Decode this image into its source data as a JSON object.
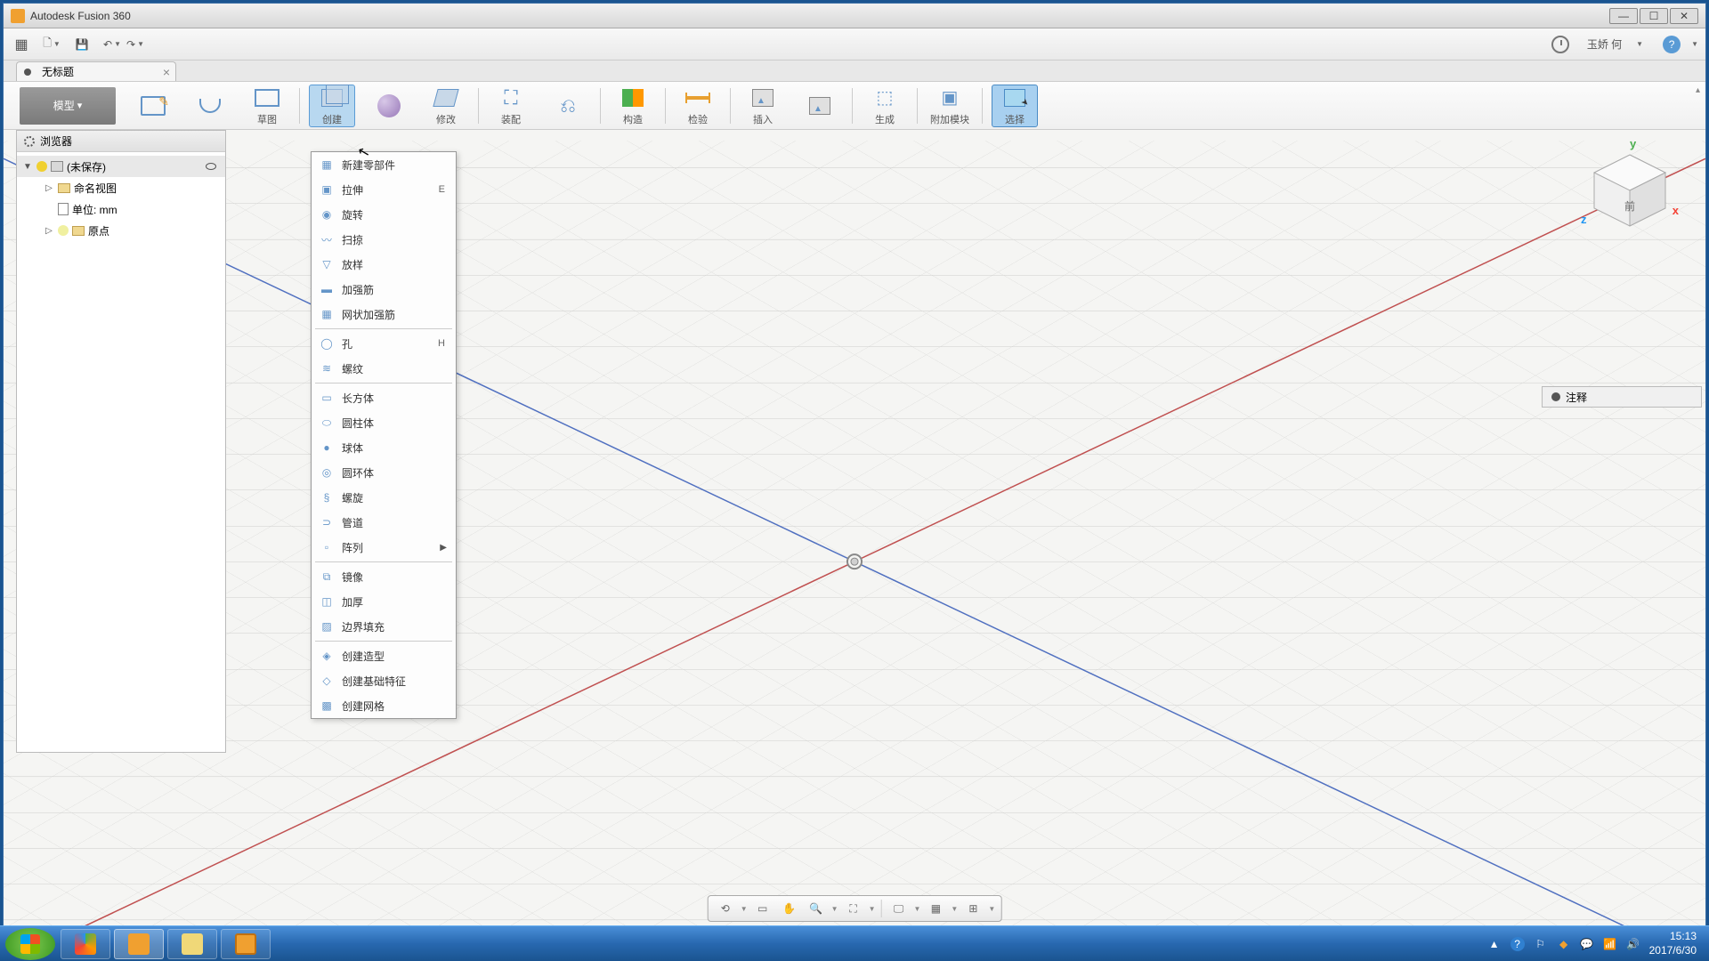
{
  "window": {
    "title": "Autodesk Fusion 360",
    "user": "玉娇 何"
  },
  "tab": {
    "title": "无标题"
  },
  "workspace": {
    "label": "模型"
  },
  "ribbon": {
    "sketch": "草图",
    "create": "创建",
    "modify": "修改",
    "assemble": "装配",
    "construct": "构造",
    "inspect": "检验",
    "insert": "插入",
    "make": "生成",
    "addins": "附加模块",
    "select": "选择"
  },
  "browser": {
    "header": "浏览器",
    "root": "(未保存)",
    "named_views": "命名视图",
    "units": "单位: mm",
    "origin": "原点"
  },
  "create_menu": {
    "items": [
      {
        "label": "新建零部件",
        "shortcut": "",
        "group": 0
      },
      {
        "label": "拉伸",
        "shortcut": "E",
        "group": 0
      },
      {
        "label": "旋转",
        "shortcut": "",
        "group": 0
      },
      {
        "label": "扫掠",
        "shortcut": "",
        "group": 0
      },
      {
        "label": "放样",
        "shortcut": "",
        "group": 0
      },
      {
        "label": "加强筋",
        "shortcut": "",
        "group": 0
      },
      {
        "label": "网状加强筋",
        "shortcut": "",
        "group": 0
      },
      {
        "label": "孔",
        "shortcut": "H",
        "group": 1
      },
      {
        "label": "螺纹",
        "shortcut": "",
        "group": 1
      },
      {
        "label": "长方体",
        "shortcut": "",
        "group": 2
      },
      {
        "label": "圆柱体",
        "shortcut": "",
        "group": 2
      },
      {
        "label": "球体",
        "shortcut": "",
        "group": 2
      },
      {
        "label": "圆环体",
        "shortcut": "",
        "group": 2
      },
      {
        "label": "螺旋",
        "shortcut": "",
        "group": 2
      },
      {
        "label": "管道",
        "shortcut": "",
        "group": 2
      },
      {
        "label": "阵列",
        "shortcut": "",
        "group": 2,
        "submenu": true
      },
      {
        "label": "镜像",
        "shortcut": "",
        "group": 3
      },
      {
        "label": "加厚",
        "shortcut": "",
        "group": 3
      },
      {
        "label": "边界填充",
        "shortcut": "",
        "group": 3
      },
      {
        "label": "创建造型",
        "shortcut": "",
        "group": 4
      },
      {
        "label": "创建基础特征",
        "shortcut": "",
        "group": 4
      },
      {
        "label": "创建网格",
        "shortcut": "",
        "group": 4
      }
    ]
  },
  "annotation": {
    "label": "注释"
  },
  "viewcube": {
    "x": "x",
    "y": "y",
    "z": "z",
    "face": "前"
  },
  "taskbar": {
    "time": "15:13",
    "date": "2017/6/30"
  }
}
